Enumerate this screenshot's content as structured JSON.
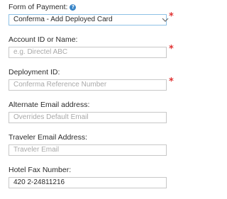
{
  "form": {
    "payment": {
      "label": "Form of Payment:",
      "help_icon": "question-icon",
      "selected": "Conferma - Add Deployed Card",
      "required_mark": "*"
    },
    "account": {
      "label": "Account ID or Name:",
      "placeholder": "e.g. Directel ABC",
      "required_mark": "*"
    },
    "deployment": {
      "label": "Deployment ID:",
      "placeholder": "Conferma Reference Number",
      "required_mark": "*"
    },
    "alternate_email": {
      "label": "Alternate Email address:",
      "placeholder": "Overrides Default Email"
    },
    "traveler_email": {
      "label": "Traveler Email Address:",
      "placeholder": "Traveler Email"
    },
    "hotel_fax": {
      "label": "Hotel Fax Number:",
      "value": "420 2-24811216"
    }
  },
  "colors": {
    "required": "#e03333",
    "select_border": "#8ec1e6",
    "help_icon": "#3a86c8"
  }
}
